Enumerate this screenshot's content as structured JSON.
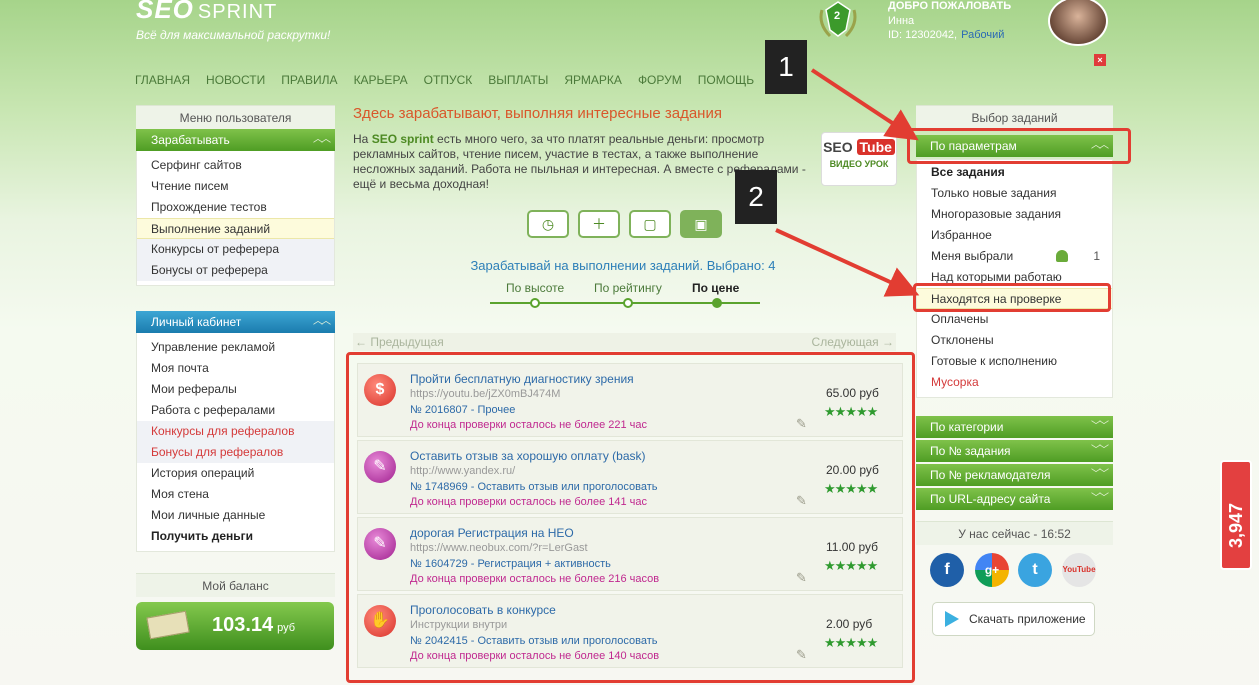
{
  "header": {
    "logo_main": "SEO",
    "logo_sub": "SPRINT",
    "tagline": "Всё для максимальной раскрутки!",
    "rank_badge": "2",
    "welcome": "ДОБРО ПОЖАЛОВАТЬ",
    "user_name": "Инна",
    "user_id": "ID: 12302042,",
    "user_status": "Рабочий",
    "close_icon": "×"
  },
  "nav": [
    "ГЛАВНАЯ",
    "НОВОСТИ",
    "ПРАВИЛА",
    "КАРЬЕРА",
    "ОТПУСК",
    "ВЫПЛАТЫ",
    "ЯРМАРКА",
    "ФОРУМ",
    "ПОМОЩЬ"
  ],
  "left_sidebar": {
    "title": "Меню пользователя",
    "earn_header": "Зарабатывать",
    "earn_items": [
      "Серфинг сайтов",
      "Чтение писем",
      "Прохождение тестов",
      "Выполнение заданий",
      "Конкурсы от реферера",
      "Бонусы от реферера"
    ],
    "cabinet_header": "Личный кабинет",
    "cabinet_items": [
      "Управление рекламой",
      "Моя почта",
      "Мои рефералы",
      "Работа с рефералами",
      "Конкурсы для рефералов",
      "Бонусы для рефералов",
      "История операций",
      "Моя стена",
      "Мои личные данные",
      "Получить деньги"
    ],
    "balance_title": "Мой баланс",
    "balance_amount": "103.14",
    "balance_currency": "руб"
  },
  "center": {
    "title": "Здесь зарабатывают, выполняя интересные задания",
    "intro_prefix": "На",
    "intro_brand": "SEO sprint",
    "intro_text": "есть много чего, за что платят реальные деньги: просмотр рекламных сайтов, чтение писем, участие в тестах, а также выполнение несложных заданий. Работа не пыльная и интересная. А вместе с рефералами - ещё и весьма доходная!",
    "video": {
      "seo": "SEO",
      "tube": "Tube",
      "label": "ВИДЕО УРОК"
    },
    "earn_title": "Зарабатывай на выполнении заданий. Выбрано: 4",
    "sort_tabs": [
      "По высоте",
      "По рейтингу",
      "По цене"
    ],
    "pager_prev": "← Предыдущая",
    "pager_next": "Следующая →",
    "tasks": [
      {
        "title": "Пройти бесплатную диагностику зрения",
        "url": "https://youtu.be/jZX0mBJ474M",
        "num": "№ 2016807 - Прочее",
        "deadline": "До конца проверки осталось не более 221 час",
        "price": "65.00 руб",
        "icon": "$",
        "rating": 5
      },
      {
        "title": "Оставить отзыв за хорошую оплату (bask)",
        "url": "http://www.yandex.ru/",
        "num": "№ 1748969 - Оставить отзыв или проголосовать",
        "deadline": "До конца проверки осталось не более 141 час",
        "price": "20.00 руб",
        "icon": "✎",
        "rating": 5
      },
      {
        "title": "дорогая Регистрация на НЕО",
        "url": "https://www.neobux.com/?r=LerGast",
        "num": "№ 1604729 - Регистрация + активность",
        "deadline": "До конца проверки осталось не более 216 часов",
        "price": "11.00 руб",
        "icon": "✎",
        "rating": 5
      },
      {
        "title": "Проголосовать в конкурсе",
        "url": "Инструкции внутри",
        "num": "№ 2042415 - Оставить отзыв или проголосовать",
        "deadline": "До конца проверки осталось не более 140 часов",
        "price": "2.00 руб",
        "icon": "✋",
        "rating": 5
      }
    ]
  },
  "right_sidebar": {
    "title": "Выбор заданий",
    "params_header": "По параметрам",
    "items": [
      "Все задания",
      "Только новые задания",
      "Многоразовые задания",
      "Избранное",
      "Меня выбрали",
      "Над которыми работаю",
      "Находятся на проверке",
      "Оплачены",
      "Отклонены",
      "Готовые к исполнению",
      "Мусорка"
    ],
    "chosen_count": "1",
    "filter_bars": [
      "По категории",
      "По № задания",
      "По № рекламодателя",
      "По URL-адресу сайта"
    ],
    "now_label": "У нас сейчас - 16:52",
    "social": [
      "f",
      "g+",
      "t",
      "YouTube"
    ],
    "app_button": "Скачать приложение"
  },
  "counter": "3,947",
  "annotations": [
    "1",
    "2"
  ],
  "colors": {
    "accent_green": "#4f9d24",
    "blue_bar": "#1b7cae",
    "annotation_red": "#e23d32",
    "title_orange": "#d9572b",
    "link_blue": "#2d6aa8"
  }
}
